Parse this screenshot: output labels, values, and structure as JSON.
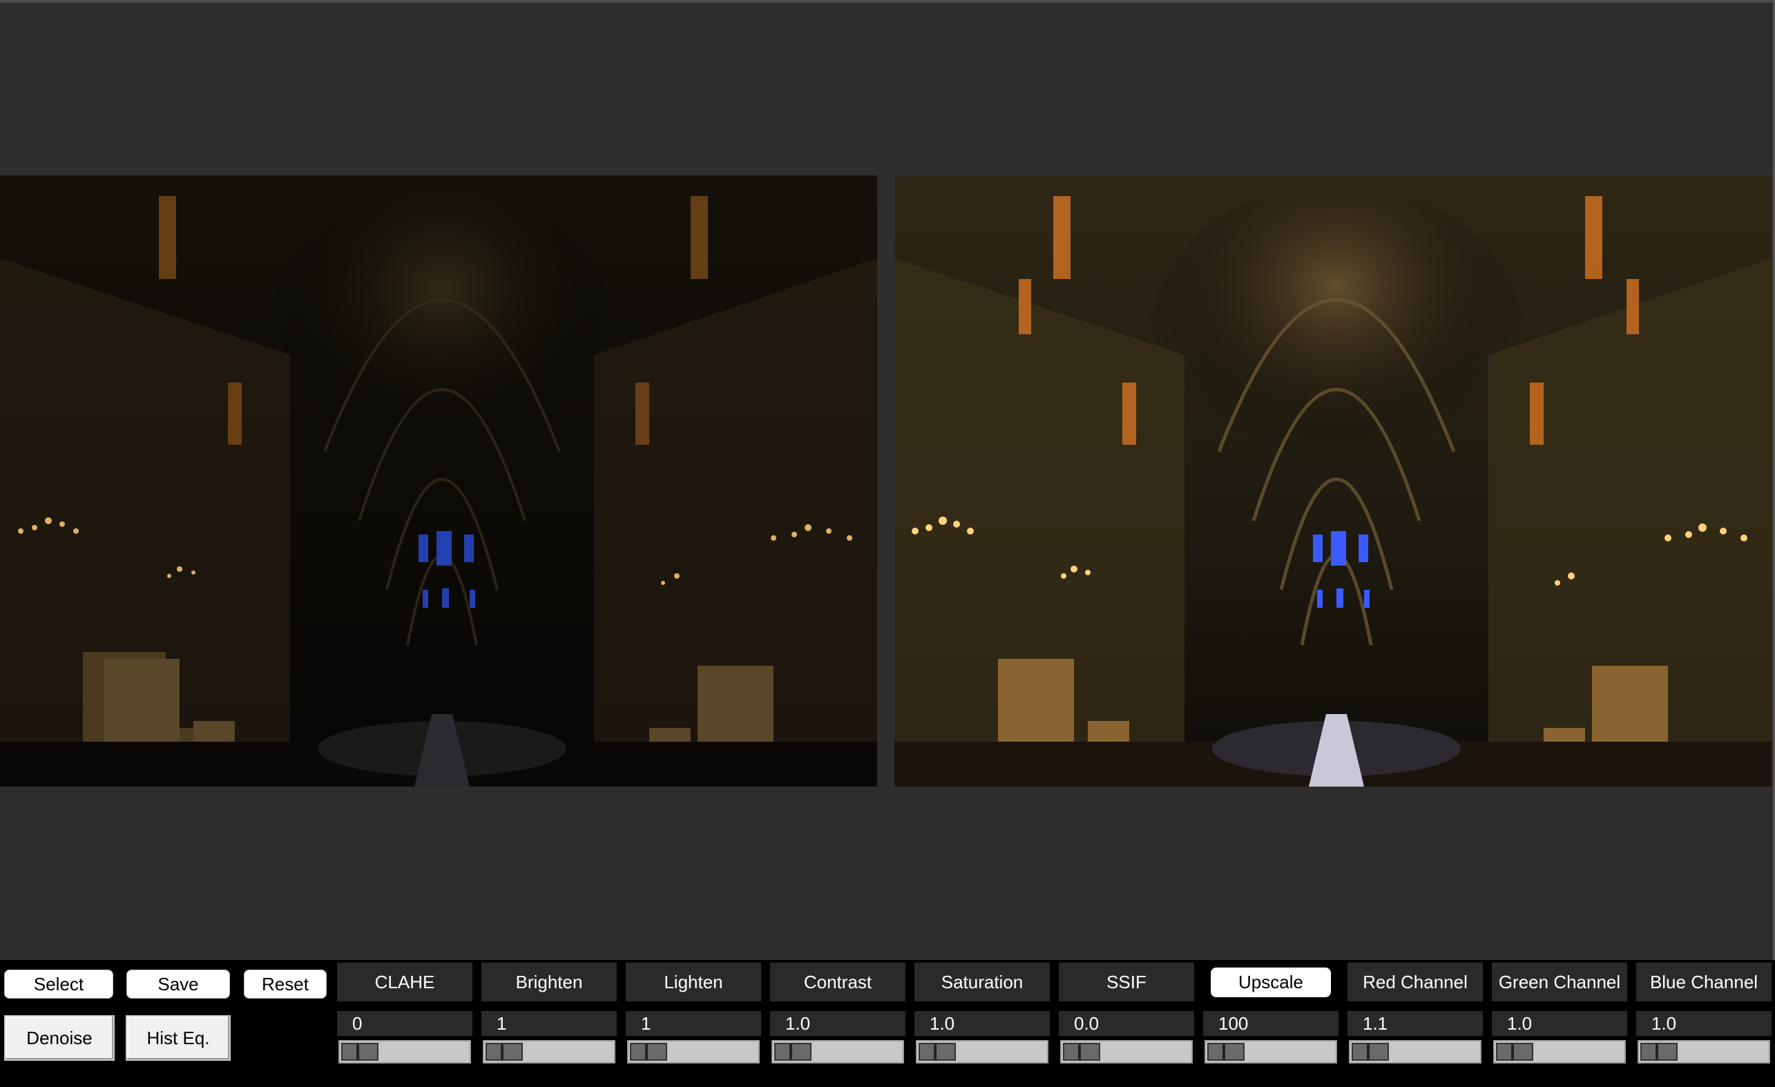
{
  "buttons": {
    "select": "Select",
    "save": "Save",
    "reset": "Reset",
    "denoise": "Denoise",
    "hist_eq": "Hist Eq."
  },
  "adjustments": [
    {
      "label": "CLAHE",
      "value": "0",
      "slider_fraction": 0.0,
      "active": false
    },
    {
      "label": "Brighten",
      "value": "1",
      "slider_fraction": 0.0,
      "active": false
    },
    {
      "label": "Lighten",
      "value": "1",
      "slider_fraction": 0.0,
      "active": false
    },
    {
      "label": "Contrast",
      "value": "1.0",
      "slider_fraction": 0.0,
      "active": false
    },
    {
      "label": "Saturation",
      "value": "1.0",
      "slider_fraction": 0.0,
      "active": false
    },
    {
      "label": "SSIF",
      "value": "0.0",
      "slider_fraction": 0.0,
      "active": false
    },
    {
      "label": "Upscale",
      "value": "100",
      "slider_fraction": 0.0,
      "active": true
    },
    {
      "label": "Red Channel",
      "value": "1.1",
      "slider_fraction": 0.0,
      "active": false
    },
    {
      "label": "Green Channel",
      "value": "1.0",
      "slider_fraction": 0.0,
      "active": false
    },
    {
      "label": "Blue Channel",
      "value": "1.0",
      "slider_fraction": 0.0,
      "active": false
    }
  ],
  "colors": {
    "window_bg": "#2e2e2e",
    "controls_bg": "#000000",
    "header_bg": "#2a2a2a",
    "warm_light": "#e8a040",
    "stained_glass": "#3a5cff"
  }
}
